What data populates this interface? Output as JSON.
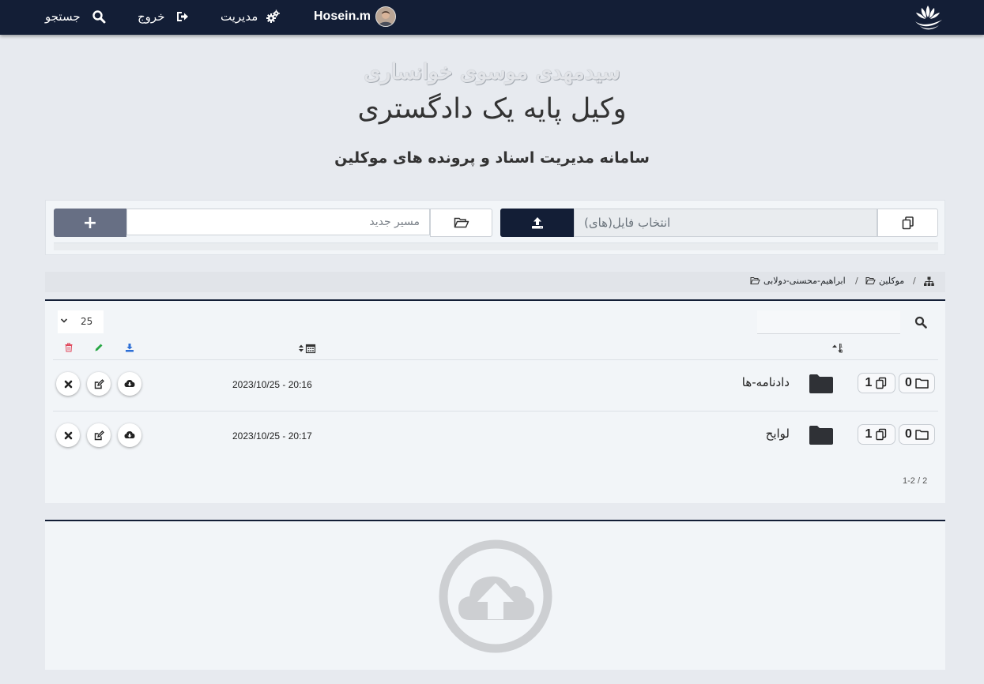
{
  "nav": {
    "user_name": "Hosein.m",
    "manage_label": "مدیریت",
    "logout_label": "خروج",
    "search_label": "جستجو"
  },
  "header": {
    "name": "سیدمهدی موسوی خوانساری",
    "role": "وکیل پایه یک دادگستری",
    "subtitle": "سامانه مدیریت اسناد و پرونده های موکلین"
  },
  "upload": {
    "file_placeholder": "انتخاب فایل(های)",
    "path_placeholder": "مسیر جدید",
    "add_label": "+",
    "progress": 0
  },
  "breadcrumb": {
    "items": [
      "موکلین",
      "ابراهیم-محسنی-دولابی"
    ],
    "separator": "/"
  },
  "table": {
    "page_size": "25",
    "rows": [
      {
        "name": "دادنامه-ها",
        "date": "2023/10/25 - 20:16",
        "folders": "0",
        "files": "1"
      },
      {
        "name": "لوایح",
        "date": "2023/10/25 - 20:17",
        "folders": "0",
        "files": "1"
      }
    ],
    "pager_info": "2 / 1-2"
  },
  "colors": {
    "navbar": "#131e36",
    "add_button": "#676f84",
    "download_icon": "#2d6fd6",
    "edit_icon": "#28a745",
    "delete_icon": "#e0465a"
  }
}
